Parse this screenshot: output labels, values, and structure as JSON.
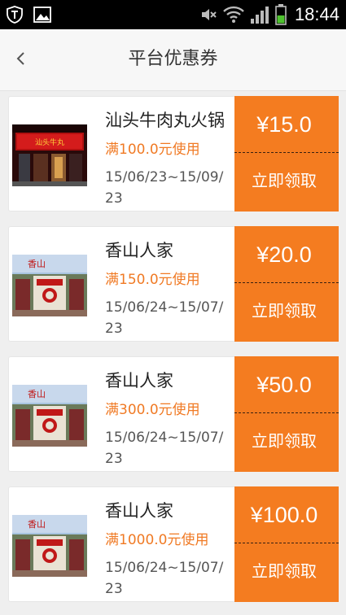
{
  "status_bar": {
    "time": "18:44",
    "left_icons": [
      "shield-app-icon",
      "gallery-icon"
    ],
    "right_icons": [
      "mute-icon",
      "wifi-icon",
      "signal-icon",
      "battery-icon"
    ],
    "battery_level": 0.5
  },
  "header": {
    "back_icon": "chevron-left-icon",
    "title": "平台优惠券"
  },
  "coupons": [
    {
      "shop": "汕头牛肉丸火锅",
      "condition": "满100.0元使用",
      "validity": "15/06/23~15/09/23",
      "amount": "¥15.0",
      "action": "立即领取",
      "image": "hotpot-storefront"
    },
    {
      "shop": "香山人家",
      "condition": "满150.0元使用",
      "validity": "15/06/24~15/07/23",
      "amount": "¥20.0",
      "action": "立即领取",
      "image": "restaurant-gate"
    },
    {
      "shop": "香山人家",
      "condition": "满300.0元使用",
      "validity": "15/06/24~15/07/23",
      "amount": "¥50.0",
      "action": "立即领取",
      "image": "restaurant-gate"
    },
    {
      "shop": "香山人家",
      "condition": "满1000.0元使用",
      "validity": "15/06/24~15/07/23",
      "amount": "¥100.0",
      "action": "立即领取",
      "image": "restaurant-gate"
    }
  ],
  "colors": {
    "accent": "#f47c20",
    "condition_text": "#f07a24",
    "background": "#efefef"
  }
}
